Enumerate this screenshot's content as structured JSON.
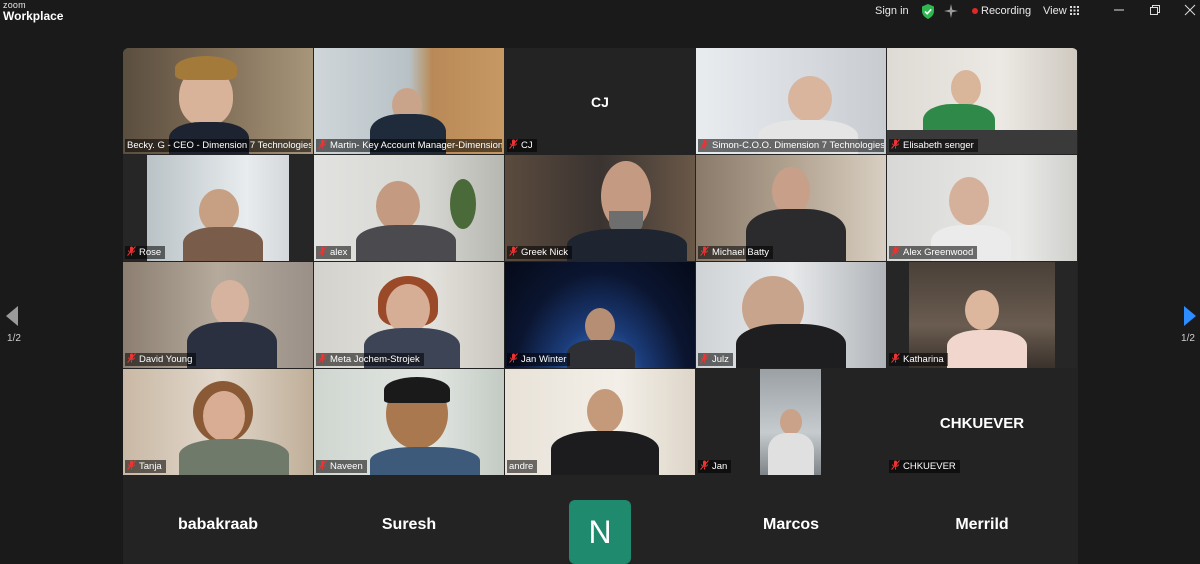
{
  "app": {
    "brand_top": "zoom",
    "brand_bottom": "Workplace"
  },
  "topbar": {
    "sign_in": "Sign in",
    "recording": "Recording",
    "view": "View",
    "colors": {
      "shield": "#2fb84f",
      "rec_dot": "#e02828"
    }
  },
  "pager": {
    "left": "1/2",
    "right": "1/2"
  },
  "tiles": [
    {
      "name": "Becky. G - CEO - Dimension 7 Technologies",
      "active_speaker": true,
      "muted": false
    },
    {
      "name": "Martin- Key Account Manager-Dimension 7",
      "muted": true
    },
    {
      "name": "CJ",
      "center_label": "CJ",
      "muted": true
    },
    {
      "name": "Simon-C.O.O. Dimension 7 Technologies",
      "muted": true
    },
    {
      "name": "Elisabeth senger",
      "muted": true
    },
    {
      "name": "Rose",
      "muted": true
    },
    {
      "name": "alex",
      "muted": true
    },
    {
      "name": "Greek Nick",
      "muted": true
    },
    {
      "name": "Michael Batty",
      "muted": true
    },
    {
      "name": "Alex Greenwood",
      "muted": true
    },
    {
      "name": "David Young",
      "muted": true
    },
    {
      "name": "Meta Jochem-Strojek",
      "muted": true
    },
    {
      "name": "Jan Winter",
      "muted": true
    },
    {
      "name": "Julz",
      "muted": true
    },
    {
      "name": "Katharina",
      "muted": true
    },
    {
      "name": "Tanja",
      "muted": true
    },
    {
      "name": "Naveen",
      "muted": true
    },
    {
      "name": "andre",
      "muted": false
    },
    {
      "name": "Jan",
      "muted": true
    },
    {
      "name": "CHKUEVER",
      "center_label": "CHKUEVER",
      "muted": true
    }
  ],
  "audio_only": [
    {
      "name": "babakraab"
    },
    {
      "name": "Suresh"
    },
    {
      "avatar_letter": "N",
      "avatar_color": "#1f8a6e"
    },
    {
      "name": "Marcos"
    },
    {
      "name": "Merrild"
    }
  ]
}
